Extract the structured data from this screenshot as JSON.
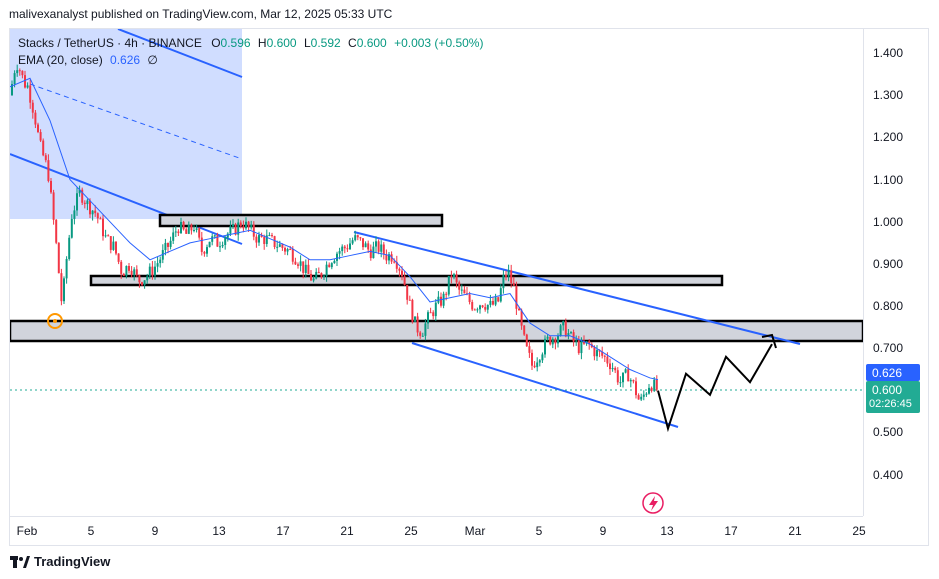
{
  "header": {
    "published_text": "malivexanalyst published on TradingView.com, Mar 12, 2025 05:33 UTC"
  },
  "legend": {
    "symbol": "Stacks / TetherUS · 4h · BINANCE",
    "o_label": "O",
    "o_value": "0.596",
    "h_label": "H",
    "h_value": "0.600",
    "l_label": "L",
    "l_value": "0.592",
    "c_label": "C",
    "c_value": "0.600",
    "change": "+0.003 (+0.50%)",
    "ema_label": "EMA (20, close)",
    "ema_value": "0.626",
    "ema_extra": "∅"
  },
  "price_axis": {
    "ticks": [
      "1.400",
      "1.300",
      "1.200",
      "1.100",
      "1.000",
      "0.900",
      "0.800",
      "0.700",
      "0.500",
      "0.400"
    ],
    "ema_tag": "0.626",
    "price_tag": "0.600",
    "countdown": "02:26:45"
  },
  "time_axis": {
    "ticks": [
      "Feb",
      "5",
      "9",
      "13",
      "17",
      "21",
      "25",
      "Mar",
      "5",
      "9",
      "13",
      "17",
      "21",
      "25"
    ]
  },
  "footer": {
    "brand": "TradingView"
  },
  "colors": {
    "up": "#089981",
    "down": "#f23645",
    "ema": "#2962ff",
    "channel": "#2962ff",
    "zone_fill": "#d1d4dc",
    "price_tag": "#22ab94",
    "ema_tag": "#2962ff"
  },
  "chart_data": {
    "type": "candlestick",
    "title": "Stacks / TetherUS · 4h · BINANCE",
    "ylim": [
      0.35,
      1.45
    ],
    "x_ticks": [
      "Feb",
      "5",
      "9",
      "13",
      "17",
      "21",
      "25",
      "Mar",
      "5",
      "9",
      "13",
      "17",
      "21",
      "25"
    ],
    "y_ticks": [
      1.4,
      1.3,
      1.2,
      1.1,
      1.0,
      0.9,
      0.8,
      0.7,
      0.5,
      0.4
    ],
    "close_path": [
      [
        0,
        1.3
      ],
      [
        6,
        1.38
      ],
      [
        10,
        1.36
      ],
      [
        14,
        1.33
      ],
      [
        18,
        1.32
      ],
      [
        24,
        1.26
      ],
      [
        30,
        1.18
      ],
      [
        38,
        1.12
      ],
      [
        46,
        0.95
      ],
      [
        52,
        0.8
      ],
      [
        56,
        0.9
      ],
      [
        62,
        1.02
      ],
      [
        70,
        1.07
      ],
      [
        78,
        1.04
      ],
      [
        86,
        1.02
      ],
      [
        96,
        0.96
      ],
      [
        104,
        0.94
      ],
      [
        112,
        0.88
      ],
      [
        120,
        0.9
      ],
      [
        128,
        0.86
      ],
      [
        136,
        0.87
      ],
      [
        144,
        0.89
      ],
      [
        152,
        0.92
      ],
      [
        160,
        0.95
      ],
      [
        168,
        0.99
      ],
      [
        176,
        0.97
      ],
      [
        184,
        0.99
      ],
      [
        192,
        0.93
      ],
      [
        200,
        0.96
      ],
      [
        208,
        0.95
      ],
      [
        216,
        0.97
      ],
      [
        224,
        0.98
      ],
      [
        232,
        1.0
      ],
      [
        240,
        0.98
      ],
      [
        248,
        0.96
      ],
      [
        256,
        0.96
      ],
      [
        264,
        0.95
      ],
      [
        272,
        0.94
      ],
      [
        280,
        0.93
      ],
      [
        288,
        0.91
      ],
      [
        296,
        0.88
      ],
      [
        304,
        0.86
      ],
      [
        312,
        0.88
      ],
      [
        320,
        0.91
      ],
      [
        328,
        0.93
      ],
      [
        336,
        0.94
      ],
      [
        344,
        0.96
      ],
      [
        352,
        0.95
      ],
      [
        360,
        0.93
      ],
      [
        368,
        0.94
      ],
      [
        376,
        0.92
      ],
      [
        384,
        0.92
      ],
      [
        392,
        0.88
      ],
      [
        400,
        0.8
      ],
      [
        406,
        0.75
      ],
      [
        412,
        0.74
      ],
      [
        418,
        0.77
      ],
      [
        426,
        0.8
      ],
      [
        434,
        0.82
      ],
      [
        442,
        0.88
      ],
      [
        448,
        0.84
      ],
      [
        456,
        0.82
      ],
      [
        464,
        0.8
      ],
      [
        472,
        0.81
      ],
      [
        480,
        0.8
      ],
      [
        488,
        0.81
      ],
      [
        494,
        0.87
      ],
      [
        498,
        0.88
      ],
      [
        504,
        0.84
      ],
      [
        510,
        0.76
      ],
      [
        516,
        0.7
      ],
      [
        522,
        0.66
      ],
      [
        530,
        0.69
      ],
      [
        538,
        0.72
      ],
      [
        546,
        0.73
      ],
      [
        554,
        0.75
      ],
      [
        562,
        0.72
      ],
      [
        570,
        0.7
      ],
      [
        578,
        0.71
      ],
      [
        586,
        0.69
      ],
      [
        594,
        0.68
      ],
      [
        602,
        0.66
      ],
      [
        610,
        0.62
      ],
      [
        618,
        0.64
      ],
      [
        624,
        0.61
      ],
      [
        630,
        0.57
      ],
      [
        636,
        0.6
      ],
      [
        640,
        0.62
      ],
      [
        644,
        0.61
      ],
      [
        648,
        0.6
      ]
    ],
    "ema_path": [
      [
        0,
        1.32
      ],
      [
        20,
        1.34
      ],
      [
        40,
        1.24
      ],
      [
        60,
        1.1
      ],
      [
        80,
        1.05
      ],
      [
        100,
        1.0
      ],
      [
        120,
        0.95
      ],
      [
        140,
        0.91
      ],
      [
        160,
        0.93
      ],
      [
        180,
        0.95
      ],
      [
        200,
        0.96
      ],
      [
        220,
        0.97
      ],
      [
        240,
        0.98
      ],
      [
        260,
        0.96
      ],
      [
        280,
        0.94
      ],
      [
        300,
        0.91
      ],
      [
        320,
        0.91
      ],
      [
        340,
        0.92
      ],
      [
        360,
        0.93
      ],
      [
        380,
        0.92
      ],
      [
        400,
        0.87
      ],
      [
        420,
        0.81
      ],
      [
        440,
        0.82
      ],
      [
        460,
        0.83
      ],
      [
        480,
        0.82
      ],
      [
        500,
        0.83
      ],
      [
        520,
        0.76
      ],
      [
        540,
        0.73
      ],
      [
        560,
        0.73
      ],
      [
        580,
        0.71
      ],
      [
        600,
        0.68
      ],
      [
        620,
        0.65
      ],
      [
        640,
        0.63
      ],
      [
        648,
        0.626
      ]
    ],
    "zones": [
      {
        "label": "zone",
        "y_top": 0.77,
        "y_bottom": 0.715
      },
      {
        "label": "zone",
        "y_top": 0.87,
        "y_bottom": 0.85
      },
      {
        "label": "zone",
        "y_top": 1.015,
        "y_bottom": 0.99
      }
    ],
    "projection_path": [
      [
        648,
        0.6
      ],
      [
        658,
        0.51
      ],
      [
        676,
        0.64
      ],
      [
        700,
        0.59
      ],
      [
        716,
        0.68
      ],
      [
        740,
        0.62
      ],
      [
        762,
        0.71
      ]
    ]
  }
}
